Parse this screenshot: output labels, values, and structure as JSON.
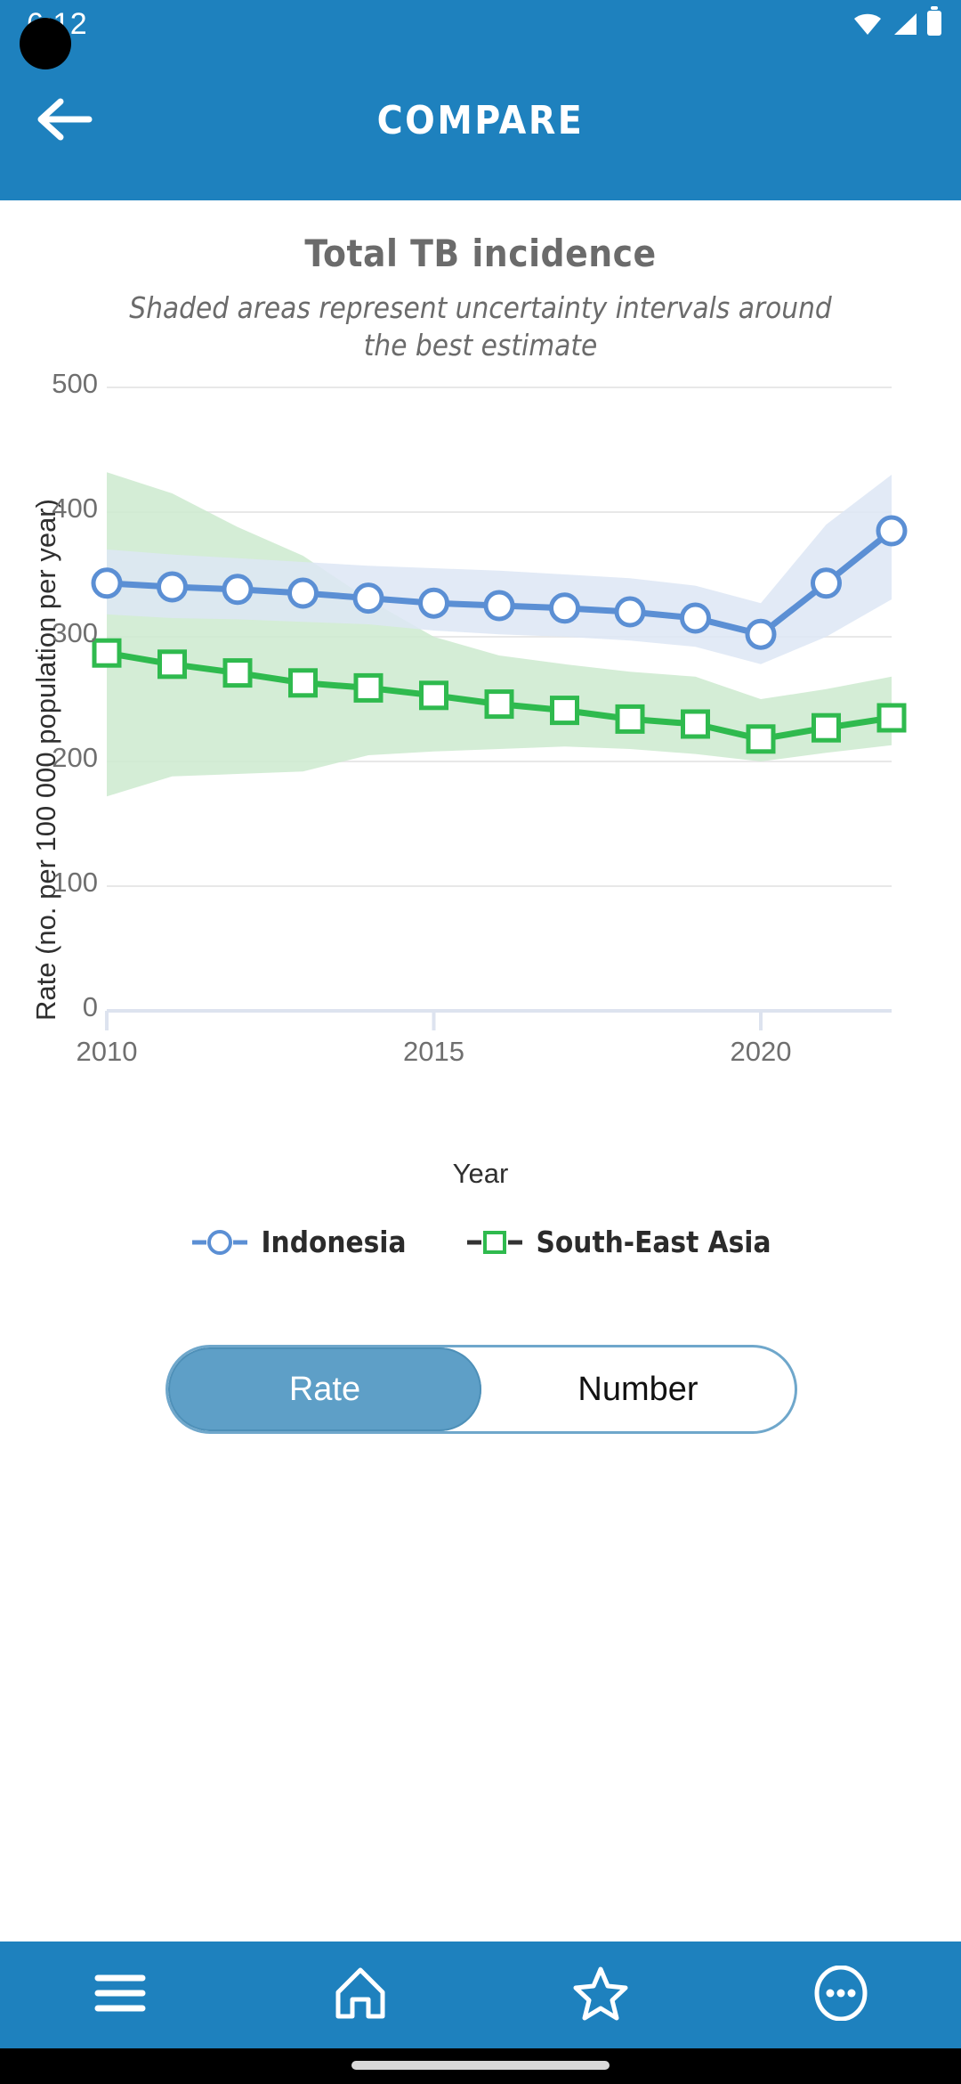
{
  "status_bar": {
    "time": "6:12",
    "icons": [
      "wifi-icon",
      "signal-icon",
      "battery-icon"
    ]
  },
  "header": {
    "title": "COMPARE",
    "back_icon": "back-arrow-icon",
    "background_color": "#1E81BE"
  },
  "chart": {
    "title": "Total TB incidence",
    "subtitle": "Shaded areas represent uncertainty intervals around the best estimate"
  },
  "toggle": {
    "options": [
      "Rate",
      "Number"
    ],
    "selected": "Rate",
    "active_color": "#5E9FC7",
    "border_color": "#6FA7CB"
  },
  "bottom_nav": {
    "items": [
      {
        "name": "menu-icon",
        "label": "Menu"
      },
      {
        "name": "home-icon",
        "label": "Home"
      },
      {
        "name": "star-icon",
        "label": "Favourites"
      },
      {
        "name": "more-icon",
        "label": "More"
      }
    ]
  },
  "chart_data": {
    "type": "line",
    "title": "Total TB incidence",
    "subtitle": "Shaded areas represent uncertainty intervals around the best estimate",
    "xlabel": "Year",
    "ylabel": "Rate (no. per 100 000 population per year)",
    "xlim": [
      2010,
      2022
    ],
    "ylim": [
      0,
      500
    ],
    "xticks": [
      2010,
      2015,
      2020
    ],
    "yticks": [
      0,
      100,
      200,
      300,
      400,
      500
    ],
    "grid": true,
    "legend_position": "bottom",
    "x": [
      2010,
      2011,
      2012,
      2013,
      2014,
      2015,
      2016,
      2017,
      2018,
      2019,
      2020,
      2021,
      2022
    ],
    "series": [
      {
        "name": "Indonesia",
        "color": "#5B8FD4",
        "marker": "circle",
        "band_color": "#dde6f5",
        "values": [
          343,
          340,
          338,
          335,
          331,
          327,
          325,
          323,
          320,
          315,
          302,
          343,
          385
        ],
        "lower": [
          318,
          315,
          314,
          312,
          310,
          305,
          302,
          300,
          297,
          292,
          278,
          300,
          330
        ],
        "upper": [
          370,
          366,
          363,
          360,
          357,
          355,
          353,
          350,
          347,
          341,
          327,
          390,
          430
        ]
      },
      {
        "name": "South-East Asia",
        "color": "#2FBA4E",
        "marker": "square",
        "band_color": "#cceacf",
        "values": [
          287,
          278,
          271,
          263,
          259,
          253,
          246,
          241,
          234,
          230,
          218,
          227,
          235
        ],
        "lower": [
          172,
          188,
          190,
          192,
          205,
          208,
          210,
          212,
          210,
          206,
          200,
          207,
          213
        ],
        "upper": [
          432,
          415,
          388,
          365,
          330,
          300,
          285,
          278,
          272,
          268,
          250,
          258,
          268
        ]
      }
    ]
  }
}
